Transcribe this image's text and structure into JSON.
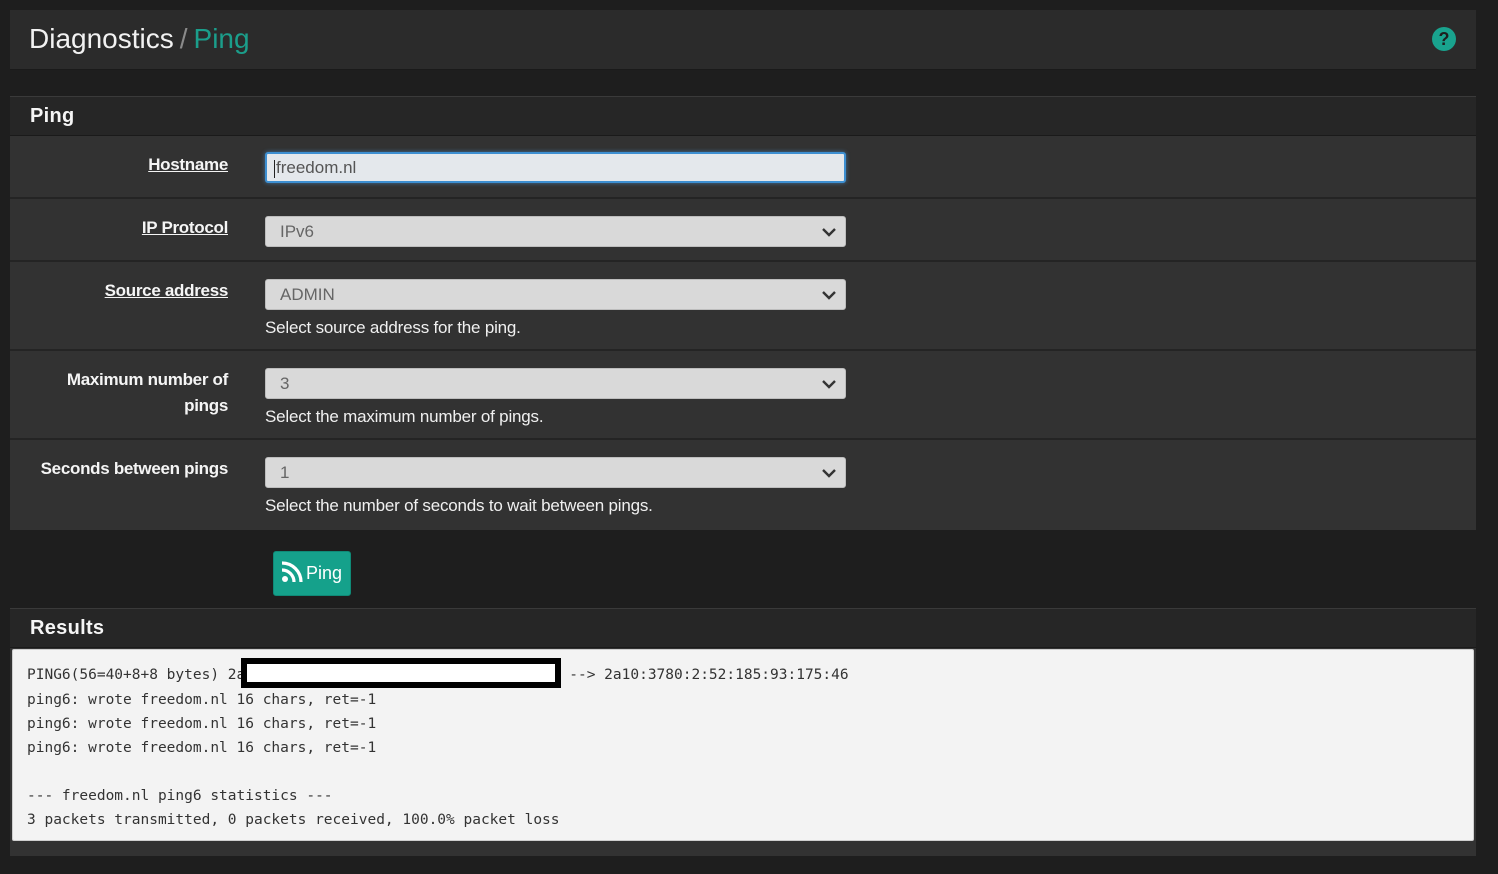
{
  "header": {
    "breadcrumb_root": "Diagnostics",
    "breadcrumb_separator": "/",
    "breadcrumb_current": "Ping",
    "help_icon": "question-circle-icon",
    "help_glyph": "?"
  },
  "ping_panel": {
    "title": "Ping",
    "hostname": {
      "label": "Hostname",
      "value": "freedom.nl"
    },
    "ip_protocol": {
      "label": "IP Protocol",
      "value": "IPv6"
    },
    "source_address": {
      "label": "Source address",
      "value": "ADMIN",
      "help": "Select source address for the ping."
    },
    "max_pings": {
      "label_line1": "Maximum number of",
      "label_line2": "pings",
      "value": "3",
      "help": "Select the maximum number of pings."
    },
    "seconds_between": {
      "label": "Seconds between pings",
      "value": "1",
      "help": "Select the number of seconds to wait between pings."
    }
  },
  "actions": {
    "ping_button_label": "Ping",
    "ping_button_icon": "rss-icon"
  },
  "results_panel": {
    "title": "Results",
    "line1_prefix": "PING6(56=40+8+8 bytes) 2a",
    "line1_suffix": "--> 2a10:3780:2:52:185:93:175:46",
    "lines": [
      "ping6: wrote freedom.nl 16 chars, ret=-1",
      "ping6: wrote freedom.nl 16 chars, ret=-1",
      "ping6: wrote freedom.nl 16 chars, ret=-1",
      "",
      "--- freedom.nl ping6 statistics ---",
      "3 packets transmitted, 0 packets received, 100.0% packet loss"
    ]
  },
  "colors": {
    "accent": "#1b9e8b",
    "background": "#1e1e1e",
    "panel": "#323232"
  }
}
